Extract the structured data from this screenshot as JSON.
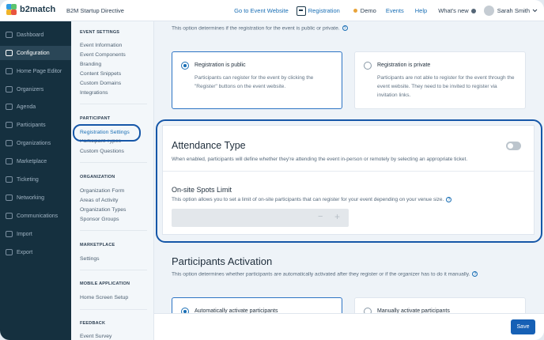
{
  "topbar": {
    "brand": "b2match",
    "event_name": "B2M Startup Directive",
    "go_to_website": "Go to Event Website",
    "registration": "Registration",
    "demo": "Demo",
    "events": "Events",
    "help": "Help",
    "whats_new": "What's new",
    "user_name": "Sarah Smith",
    "brand_colors": [
      "#2f9be3",
      "#5cc46e",
      "#f0b429",
      "#e8553f"
    ]
  },
  "sidebar": {
    "items": [
      {
        "label": "Dashboard",
        "icon": "dashboard-icon"
      },
      {
        "label": "Configuration",
        "icon": "gear-icon",
        "active": true
      },
      {
        "label": "Home Page Editor",
        "icon": "home-page-editor-icon"
      },
      {
        "label": "Organizers",
        "icon": "organizers-icon"
      },
      {
        "label": "Agenda",
        "icon": "agenda-icon"
      },
      {
        "label": "Participants",
        "icon": "participants-icon"
      },
      {
        "label": "Organizations",
        "icon": "organizations-icon"
      },
      {
        "label": "Marketplace",
        "icon": "marketplace-icon"
      },
      {
        "label": "Ticketing",
        "icon": "ticket-icon"
      },
      {
        "label": "Networking",
        "icon": "networking-icon"
      },
      {
        "label": "Communications",
        "icon": "communications-icon"
      },
      {
        "label": "Import",
        "icon": "import-icon"
      },
      {
        "label": "Export",
        "icon": "export-icon"
      }
    ]
  },
  "submenu": {
    "event_settings": {
      "heading": "EVENT SETTINGS",
      "items": [
        "Event Information",
        "Event Components",
        "Branding",
        "Content Snippets",
        "Custom Domains",
        "Integrations"
      ]
    },
    "participant": {
      "heading": "PARTICIPANT",
      "items": [
        "Registration Settings",
        "Participant Types",
        "Custom Questions"
      ]
    },
    "organization": {
      "heading": "ORGANIZATION",
      "items": [
        "Organization Form",
        "Areas of Activity",
        "Organization Types",
        "Sponsor Groups"
      ]
    },
    "marketplace": {
      "heading": "MARKETPLACE",
      "items": [
        "Settings"
      ]
    },
    "mobile": {
      "heading": "MOBILE APPLICATION",
      "items": [
        "Home Screen Setup"
      ]
    },
    "feedback": {
      "heading": "FEEDBACK",
      "items": [
        "Event Survey"
      ]
    }
  },
  "main": {
    "registration_intro": "This option determines if the registration for the event is public or private.",
    "reg_public": {
      "title": "Registration is public",
      "desc": "Participants can register for the event by clicking the \"Register\" buttons on the event website."
    },
    "reg_private": {
      "title": "Registration is private",
      "desc": "Participants are not able to register for the event through the event website. They need to be invited to register via invitation links."
    },
    "attendance": {
      "title": "Attendance Type",
      "desc": "When enabled, participants will define whether they're attending the event in-person or remotely by selecting an appropriate ticket.",
      "enabled": false
    },
    "spots": {
      "title": "On-site Spots Limit",
      "desc": "This option allows you to set a limit of on-site participants that can register for your event depending on your venue size.",
      "value": "",
      "minus": "−",
      "plus": "+"
    },
    "activation": {
      "title": "Participants Activation",
      "desc": "This option determines whether participants are automatically activated after they register or if the organizer has to do it manually.",
      "auto": "Automatically activate participants",
      "manual": "Manually activate participants"
    }
  },
  "footer": {
    "save": "Save"
  }
}
